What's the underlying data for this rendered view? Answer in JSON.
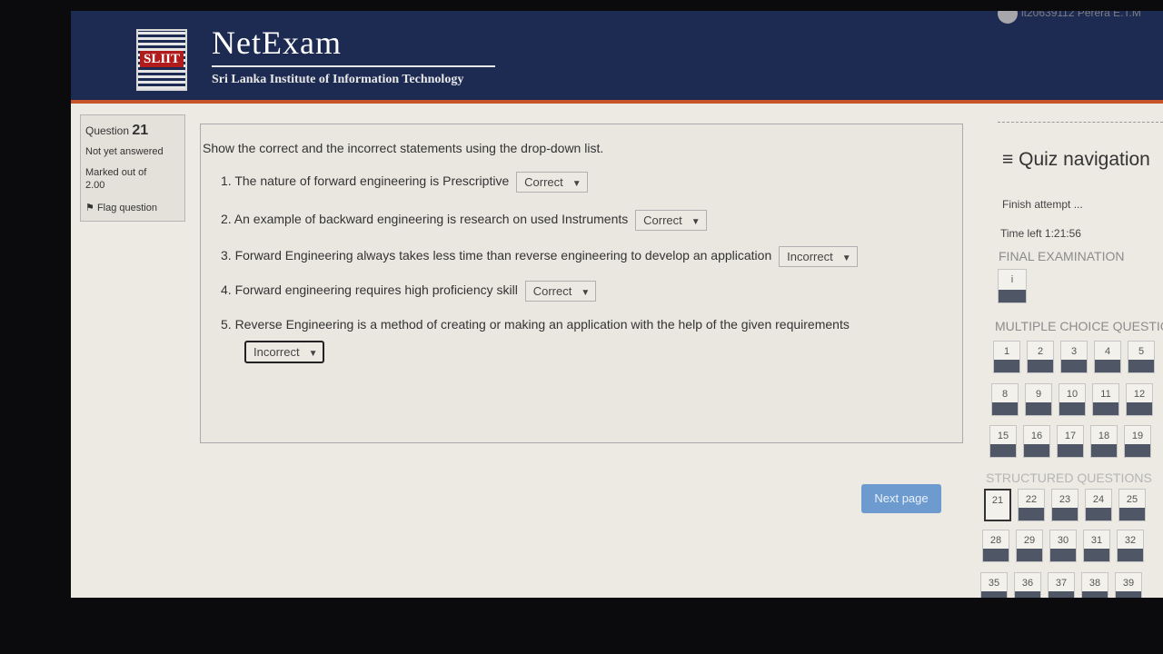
{
  "header": {
    "logo_text": "SLIIT",
    "brand": "NetExam",
    "subtitle": "Sri Lanka Institute of Information Technology",
    "user": "it20639112 Perera E.T.M"
  },
  "question_info": {
    "label": "Question",
    "number": "21",
    "status": "Not yet answered",
    "marked_out_of": "Marked out of",
    "marks": "2.00",
    "flag_label": "Flag question"
  },
  "question": {
    "prompt": "Show the correct and the incorrect statements using the drop-down list.",
    "statements": [
      {
        "text": "1. The nature of forward engineering is Prescriptive",
        "answer": "Correct"
      },
      {
        "text": "2. An example of backward engineering is research on used Instruments",
        "answer": "Correct"
      },
      {
        "text": "3. Forward Engineering always takes less time than reverse engineering to develop an application",
        "answer": "Incorrect"
      },
      {
        "text": "4. Forward engineering requires high proficiency skill",
        "answer": "Correct"
      },
      {
        "text": "5. Reverse Engineering is a method of creating or making an application with the help of the given requirements",
        "answer": "Incorrect"
      }
    ]
  },
  "next_button": "Next page",
  "quiz_nav": {
    "title": "Quiz navigation",
    "finish": "Finish attempt ...",
    "time_left_label": "Time left",
    "time_left": "1:21:56",
    "final_section": "FINAL EXAMINATION",
    "info_button": "i",
    "mcq_section": "MULTIPLE CHOICE QUESTIO",
    "mcq_rows": [
      [
        "1",
        "2",
        "3",
        "4",
        "5"
      ],
      [
        "8",
        "9",
        "10",
        "11",
        "12"
      ],
      [
        "15",
        "16",
        "17",
        "18",
        "19"
      ]
    ],
    "structured_section": "STRUCTURED QUESTIONS",
    "structured_rows": [
      [
        "21",
        "22",
        "23",
        "24",
        "25"
      ],
      [
        "28",
        "29",
        "30",
        "31",
        "32"
      ],
      [
        "35",
        "36",
        "37",
        "38",
        "39"
      ]
    ],
    "current": "21"
  }
}
